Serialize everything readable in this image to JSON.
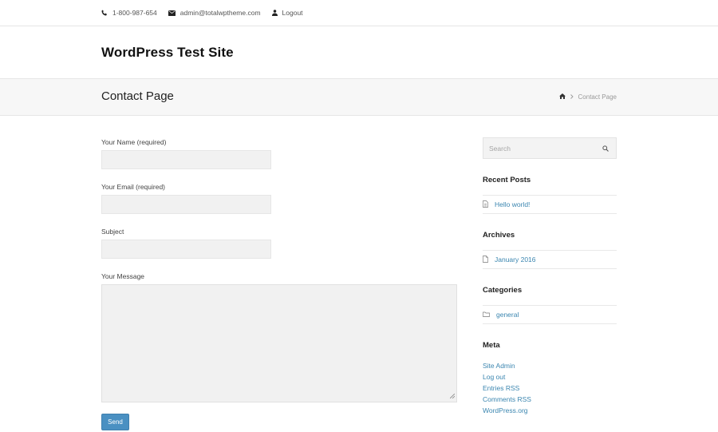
{
  "topbar": {
    "phone": "1-800-987-654",
    "email": "admin@totalwptheme.com",
    "logout": "Logout"
  },
  "header": {
    "site_title": "WordPress Test Site"
  },
  "page_header": {
    "title": "Contact Page",
    "breadcrumb_current": "Contact Page"
  },
  "form": {
    "name_label": "Your Name (required)",
    "name_value": "",
    "email_label": "Your Email (required)",
    "email_value": "",
    "subject_label": "Subject",
    "subject_value": "",
    "message_label": "Your Message",
    "message_value": "",
    "send_label": "Send"
  },
  "sidebar": {
    "search_placeholder": "Search",
    "recent_posts_title": "Recent Posts",
    "recent_posts": [
      "Hello world!"
    ],
    "archives_title": "Archives",
    "archives": [
      "January 2016"
    ],
    "categories_title": "Categories",
    "categories": [
      "general"
    ],
    "meta_title": "Meta",
    "meta_links": [
      "Site Admin",
      "Log out",
      "Entries RSS",
      "Comments RSS",
      "WordPress.org"
    ]
  },
  "colors": {
    "link": "#3b86b0",
    "button": "#4a90c2",
    "page_header_bg": "#f7f7f7",
    "input_bg": "#f1f1f1"
  },
  "icons": {
    "phone": "phone-icon",
    "email": "envelope-icon",
    "logout": "user-icon",
    "breadcrumb_home": "home-icon",
    "search": "search-icon",
    "recent_post": "document-icon",
    "archive": "file-icon",
    "category": "folder-icon"
  }
}
